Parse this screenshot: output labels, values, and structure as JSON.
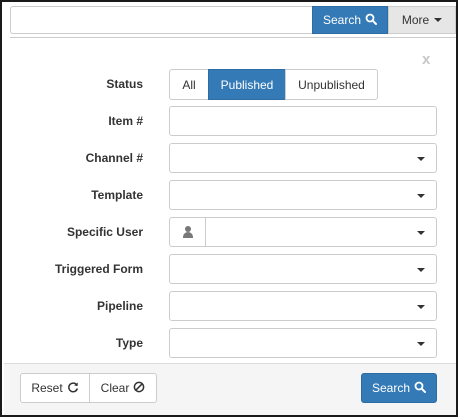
{
  "top": {
    "search_label": "Search",
    "more_label": "More"
  },
  "panel": {
    "close_label": "x"
  },
  "form": {
    "status_label": "Status",
    "status_options": [
      "All",
      "Published",
      "Unpublished"
    ],
    "status_selected": "Published",
    "item_label": "Item #",
    "item_value": "",
    "channel_label": "Channel #",
    "channel_value": "",
    "template_label": "Template",
    "template_value": "",
    "user_label": "Specific User",
    "user_value": "",
    "triggered_form_label": "Triggered Form",
    "triggered_form_value": "",
    "pipeline_label": "Pipeline",
    "pipeline_value": "",
    "type_label": "Type",
    "type_value": ""
  },
  "footer": {
    "reset_label": "Reset",
    "clear_label": "Clear",
    "search_label": "Search"
  },
  "icons": {
    "search": "search-icon",
    "refresh": "refresh-icon",
    "ban": "ban-icon",
    "user": "user-icon",
    "caret": "caret-down-icon"
  },
  "colors": {
    "primary": "#337ab7",
    "primary_border": "#2e6da4",
    "border": "#cccccc",
    "footer_bg": "#f5f5f5"
  }
}
